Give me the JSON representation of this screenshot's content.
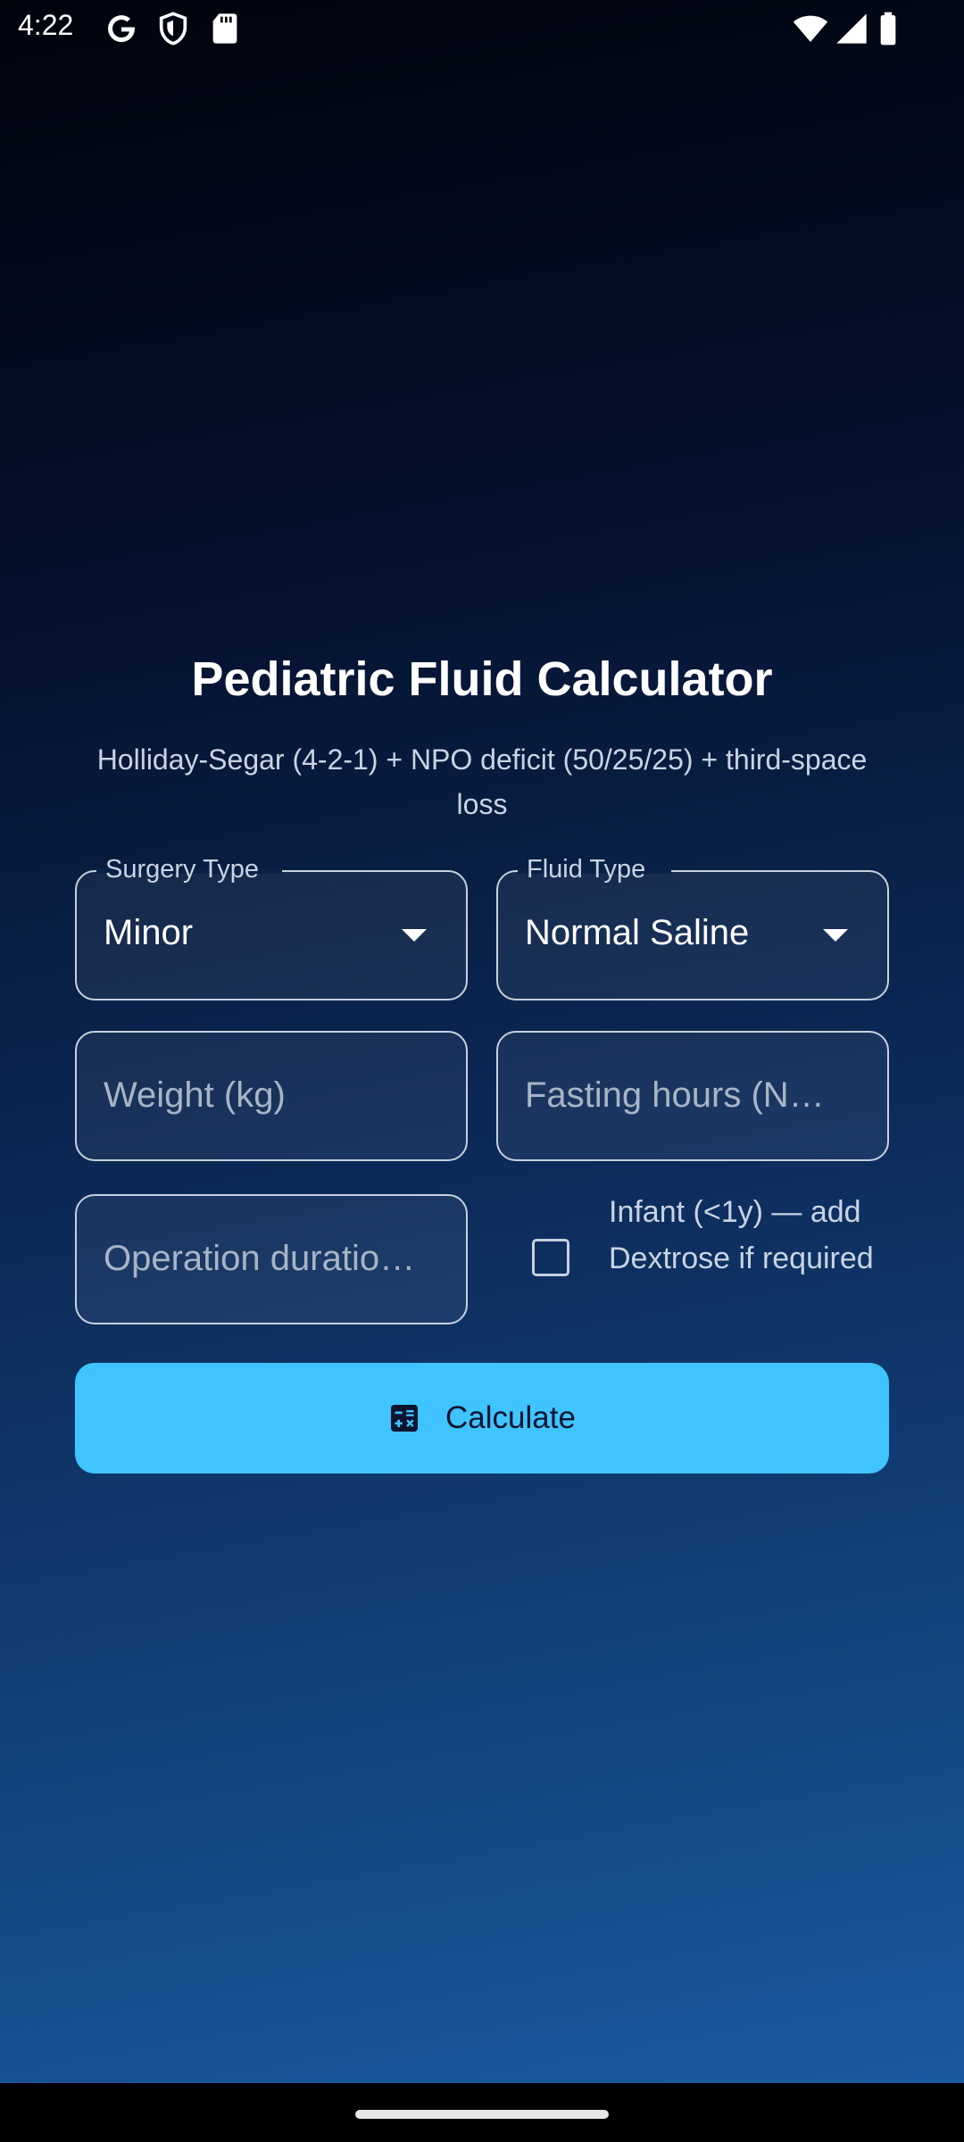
{
  "status_bar": {
    "time": "4:22",
    "left_icons": [
      "google-icon",
      "shield-icon",
      "sd-card-icon"
    ],
    "right_icons": [
      "wifi-icon",
      "signal-icon",
      "battery-icon"
    ]
  },
  "page": {
    "title": "Pediatric Fluid Calculator",
    "subtitle": "Holliday-Segar (4-2-1) + NPO deficit (50/25/25) + third-space loss"
  },
  "form": {
    "surgery_type": {
      "label": "Surgery Type",
      "value": "Minor"
    },
    "fluid_type": {
      "label": "Fluid Type",
      "value": "Normal Saline"
    },
    "weight": {
      "placeholder": "Weight (kg)"
    },
    "fasting_hours": {
      "placeholder": "Fasting hours (N…"
    },
    "operation_duration": {
      "placeholder": "Operation duratio…"
    },
    "infant_checkbox": {
      "label": "Infant (<1y) — add Dextrose if required",
      "checked": false
    },
    "calculate_button": {
      "label": "Calculate",
      "icon": "calculator-icon"
    }
  },
  "colors": {
    "accent": "#40c4ff",
    "background_top": "#01040d",
    "background_bottom": "#1a5aa0"
  }
}
